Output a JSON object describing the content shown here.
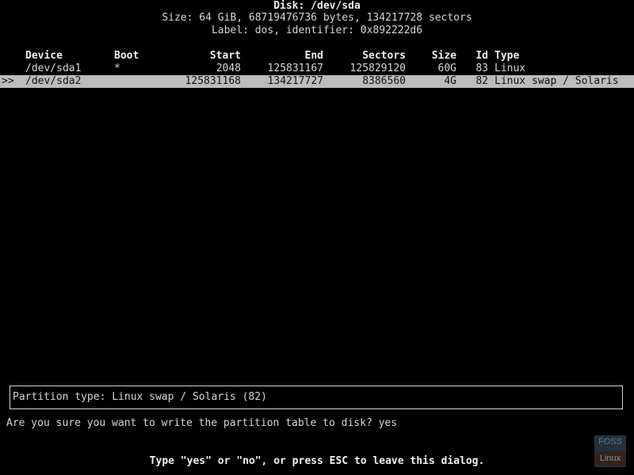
{
  "disk": {
    "title": "Disk: /dev/sda",
    "size_line": "Size: 64 GiB, 68719476736 bytes, 134217728 sectors",
    "label_line": "Label: dos, identifier: 0x892222d6"
  },
  "table": {
    "headers": {
      "device": "Device",
      "boot": "Boot",
      "start": "Start",
      "end": "End",
      "sectors": "Sectors",
      "size": "Size",
      "id": "Id",
      "type": "Type"
    },
    "rows": [
      {
        "marker": "",
        "device": "/dev/sda1",
        "boot": "*",
        "start": "2048",
        "end": "125831167",
        "sectors": "125829120",
        "size": "60G",
        "id": "83",
        "type": "Linux"
      },
      {
        "marker": ">>",
        "device": "/dev/sda2",
        "boot": "",
        "start": "125831168",
        "end": "134217727",
        "sectors": "8386560",
        "size": "4G",
        "id": "82",
        "type": "Linux swap / Solaris"
      }
    ]
  },
  "info_box": {
    "text": "Partition type: Linux swap / Solaris (82)"
  },
  "prompt": {
    "text": "Are you sure you want to write the partition table to disk? yes"
  },
  "hint": {
    "text": "Type \"yes\" or \"no\", or press ESC to leave this dialog."
  },
  "watermark": {
    "top": "FOSS",
    "bottom": "Linux"
  },
  "colors": {
    "background": "#000000",
    "text": "#d6d6d6",
    "selection": "#bcbcbc"
  }
}
